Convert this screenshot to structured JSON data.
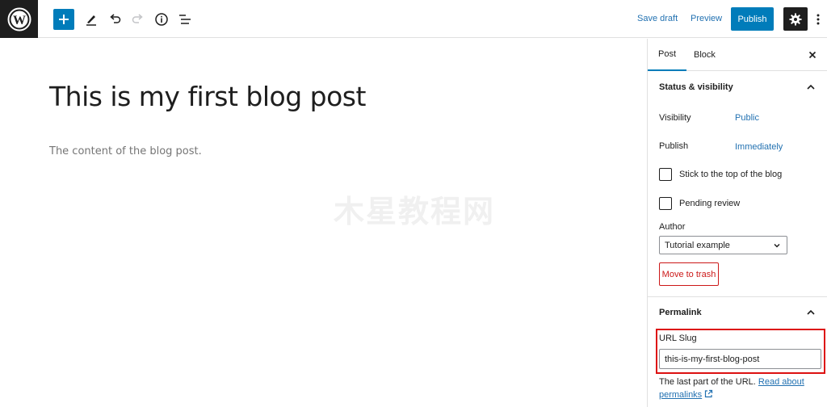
{
  "toolbar": {
    "save_draft": "Save draft",
    "preview": "Preview",
    "publish": "Publish"
  },
  "editor": {
    "title": "This is my first blog post",
    "content": "The content of the blog post."
  },
  "watermark": "木星教程网",
  "sidebar": {
    "tabs": [
      "Post",
      "Block"
    ],
    "status": {
      "heading": "Status & visibility",
      "visibility_label": "Visibility",
      "visibility_value": "Public",
      "publish_label": "Publish",
      "publish_value": "Immediately",
      "stick_label": "Stick to the top of the blog",
      "pending_label": "Pending review",
      "author_label": "Author",
      "author_value": "Tutorial example",
      "trash": "Move to trash"
    },
    "permalink": {
      "heading": "Permalink",
      "slug_label": "URL Slug",
      "slug_value": "this-is-my-first-blog-post",
      "help_text": "The last part of the URL.",
      "help_link_1": "Read about",
      "help_link_2": "permalinks"
    }
  },
  "colors": {
    "accent": "#007cba",
    "danger": "#cc1818",
    "highlight": "#dd1111"
  }
}
